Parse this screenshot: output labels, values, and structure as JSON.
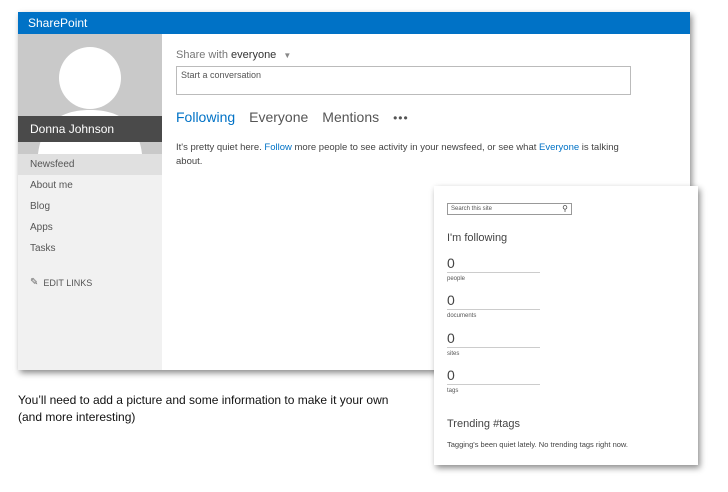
{
  "app": {
    "title": "SharePoint",
    "accent": "#0072c6"
  },
  "profile": {
    "name": "Donna Johnson"
  },
  "nav": {
    "items": [
      {
        "label": "Newsfeed",
        "active": true
      },
      {
        "label": "About me"
      },
      {
        "label": "Blog"
      },
      {
        "label": "Apps"
      },
      {
        "label": "Tasks"
      }
    ],
    "edit_links": "EDIT LINKS"
  },
  "share": {
    "prefix": "Share with",
    "audience": "everyone",
    "placeholder": "Start a conversation"
  },
  "tabs": [
    {
      "label": "Following",
      "active": true
    },
    {
      "label": "Everyone"
    },
    {
      "label": "Mentions"
    },
    {
      "label": "•••"
    }
  ],
  "feed": {
    "part1": "It's pretty quiet here. ",
    "link1": "Follow",
    "part2": " more people to see activity in your newsfeed, or see what ",
    "link2": "Everyone",
    "part3": " is talking about."
  },
  "caption": "You’ll need to add a picture and some information to make it your own (and more interesting)",
  "side": {
    "search_placeholder": "Search this site",
    "following_title": "I'm following",
    "stats": [
      {
        "value": "0",
        "label": "people"
      },
      {
        "value": "0",
        "label": "documents"
      },
      {
        "value": "0",
        "label": "sites"
      },
      {
        "value": "0",
        "label": "tags"
      }
    ],
    "trending_title": "Trending #tags",
    "trending_text": "Tagging's been quiet lately. No trending tags right now."
  }
}
